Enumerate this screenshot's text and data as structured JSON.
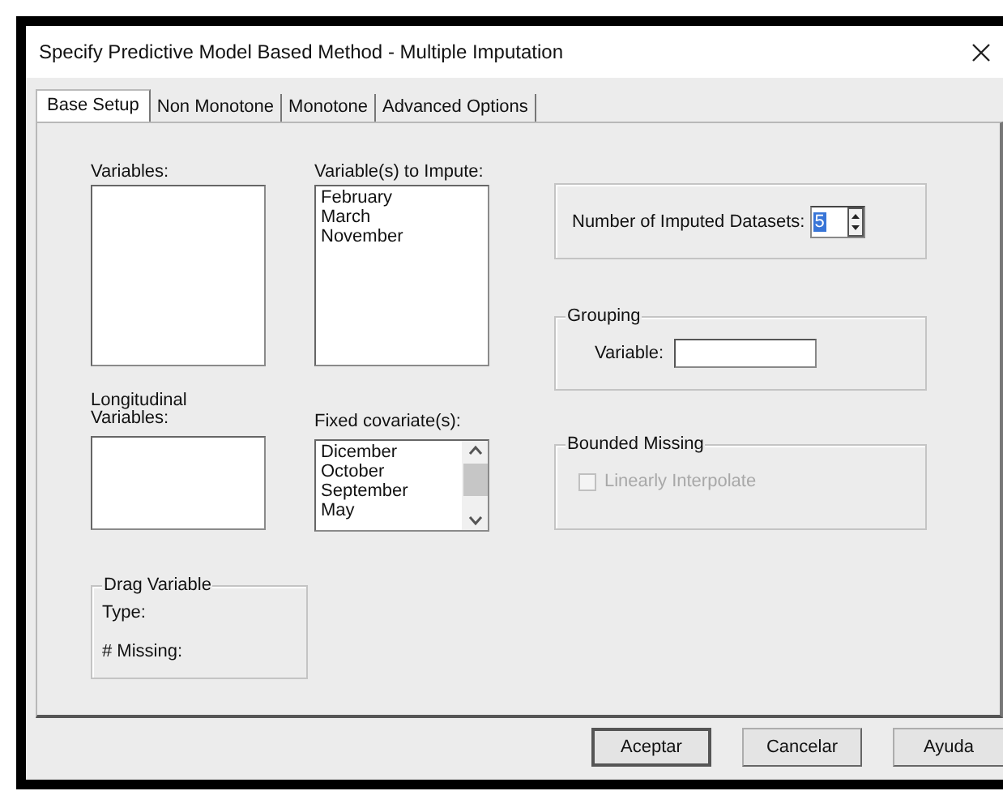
{
  "window": {
    "title": "Specify Predictive Model Based Method - Multiple Imputation"
  },
  "tabs": [
    {
      "label": "Base Setup",
      "selected": true
    },
    {
      "label": "Non Monotone",
      "selected": false
    },
    {
      "label": "Monotone",
      "selected": false
    },
    {
      "label": "Advanced Options",
      "selected": false
    }
  ],
  "variables": {
    "label": "Variables:"
  },
  "variables_to_impute": {
    "label": "Variable(s) to Impute:",
    "items": [
      "February",
      "March",
      "November"
    ]
  },
  "longitudinal_variables": {
    "label": "Longitudinal Variables:"
  },
  "fixed_covariates": {
    "label": "Fixed covariate(s):",
    "items": [
      "Dicember",
      "October",
      "September",
      "May"
    ]
  },
  "drag_variable": {
    "title": "Drag Variable",
    "type_label": "Type:",
    "missing_label": "# Missing:"
  },
  "imputed_datasets": {
    "label": "Number of Imputed Datasets:",
    "value": "5"
  },
  "grouping": {
    "title": "Grouping",
    "variable_label": "Variable:"
  },
  "bounded_missing": {
    "title": "Bounded Missing",
    "checkbox": {
      "label": "Linearly Interpolate",
      "checked": false,
      "disabled": true
    }
  },
  "buttons": [
    {
      "label": "Aceptar",
      "default": true
    },
    {
      "label": "Cancelar",
      "default": false
    },
    {
      "label": "Ayuda",
      "default": false
    }
  ]
}
